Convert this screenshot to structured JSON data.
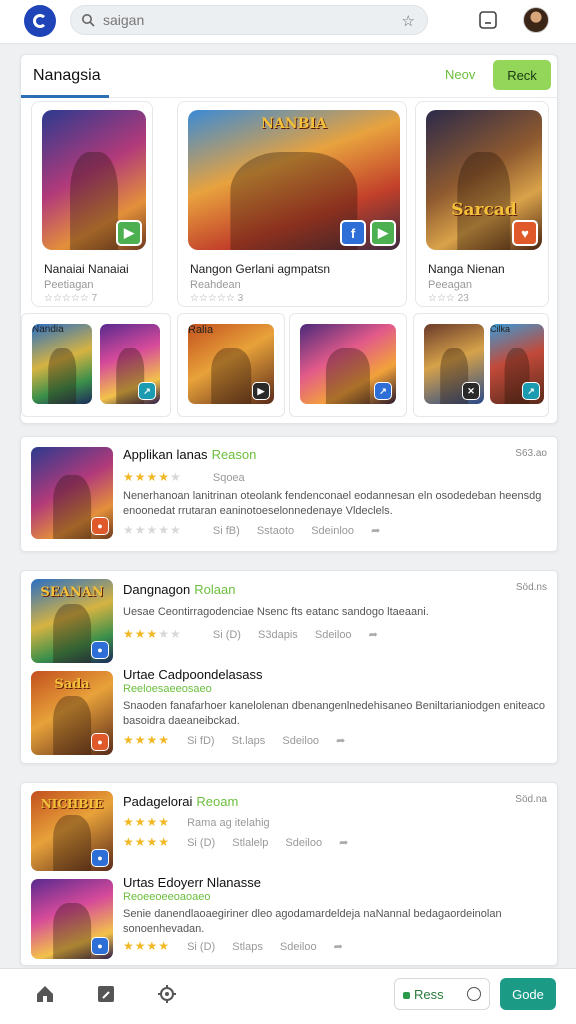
{
  "header": {
    "search_value": "saigan",
    "search_icon": "search-icon",
    "favorite_icon": "star-icon",
    "screen_icon": "screen-icon",
    "avatar_icon": "profile-avatar"
  },
  "featured": {
    "title": "Nanagsia",
    "new_label": "Neov",
    "action_label": "Reck",
    "cards": [
      {
        "title": "Nanaiai Nanaiai",
        "subtitle": "Peetiagan",
        "rating": "☆☆☆☆☆ 7",
        "banner": ""
      },
      {
        "title": "Nangon Gerlani agmpatsn",
        "subtitle": "Reahdean",
        "rating": "☆☆☆☆☆ 3",
        "banner": "NANBIA"
      },
      {
        "title": "Nanga Nienan",
        "subtitle": "Peeagan",
        "rating": "☆☆☆ 23",
        "banner": "Sarcad"
      }
    ],
    "mini_banners": [
      "Nandia",
      "Ralia",
      "Cilka"
    ]
  },
  "list": [
    {
      "name": "Applikan lanas",
      "tag": "Reason",
      "price": "S63.ao",
      "rating_count": "Sqoea",
      "description": "Nenerhanoan lanitrinan oteolank fendenconael eodannesan eln osodedeban heensdg enoonedat rrutaran eaninotoeselonnedenaye Vldeclels.",
      "meta": [
        "Si fB)",
        "Sstaoto",
        "Sdeinloo"
      ],
      "art_banner": ""
    },
    {
      "name": "Dangnagon",
      "tag": "Rolaan",
      "price": "Söd.ns",
      "description": "Uesae Ceontirragodenciae Nsenc fts eatanc sandogo ltaeaani.",
      "meta": [
        "Si (D)",
        "S3dapis",
        "Sdeiloo"
      ],
      "art_banner": "SEANAN"
    },
    {
      "name": "Urtae Cadpoondelasass",
      "subtitle": "Reeloesaeeosaeo",
      "description": "Snaoden fanafarhoer kanelolenan dbenangenlnedehisaneo Beniltarianiodgen eniteaco basoidra daeaneibckad.",
      "meta": [
        "Si fD)",
        "St.laps",
        "Sdeiloo"
      ],
      "art_banner": "Sada"
    },
    {
      "name": "Padagelorai",
      "tag": "Reoam",
      "price": "Söd.na",
      "rating_count": "Rama ag itelahig",
      "meta": [
        "Si (D)",
        "Stlalelp",
        "Sdeiloo"
      ],
      "art_banner": "NICHBIE"
    },
    {
      "name": "Urtas Edoyerr Nlanasse",
      "subtitle": "Reoeeoeeoaoaeo",
      "description": "Senie danendlaoaegiriner dleo agodamardeldeja naNannal bedagaordeinolan sonoenhevadan.",
      "meta": [
        "Si (D)",
        "Stlaps",
        "Sdeiloo"
      ],
      "art_banner": ""
    }
  ],
  "bottom_nav": {
    "home_icon": "home-icon",
    "bookmark_icon": "bookmark-icon",
    "settings_icon": "gear-icon",
    "ress_label": "Ress",
    "gode_label": "Gode"
  },
  "colors": {
    "brand": "#1f44b8",
    "accent_green": "#94d65a",
    "star": "#f2b824",
    "primary_button": "#1b9b86"
  }
}
